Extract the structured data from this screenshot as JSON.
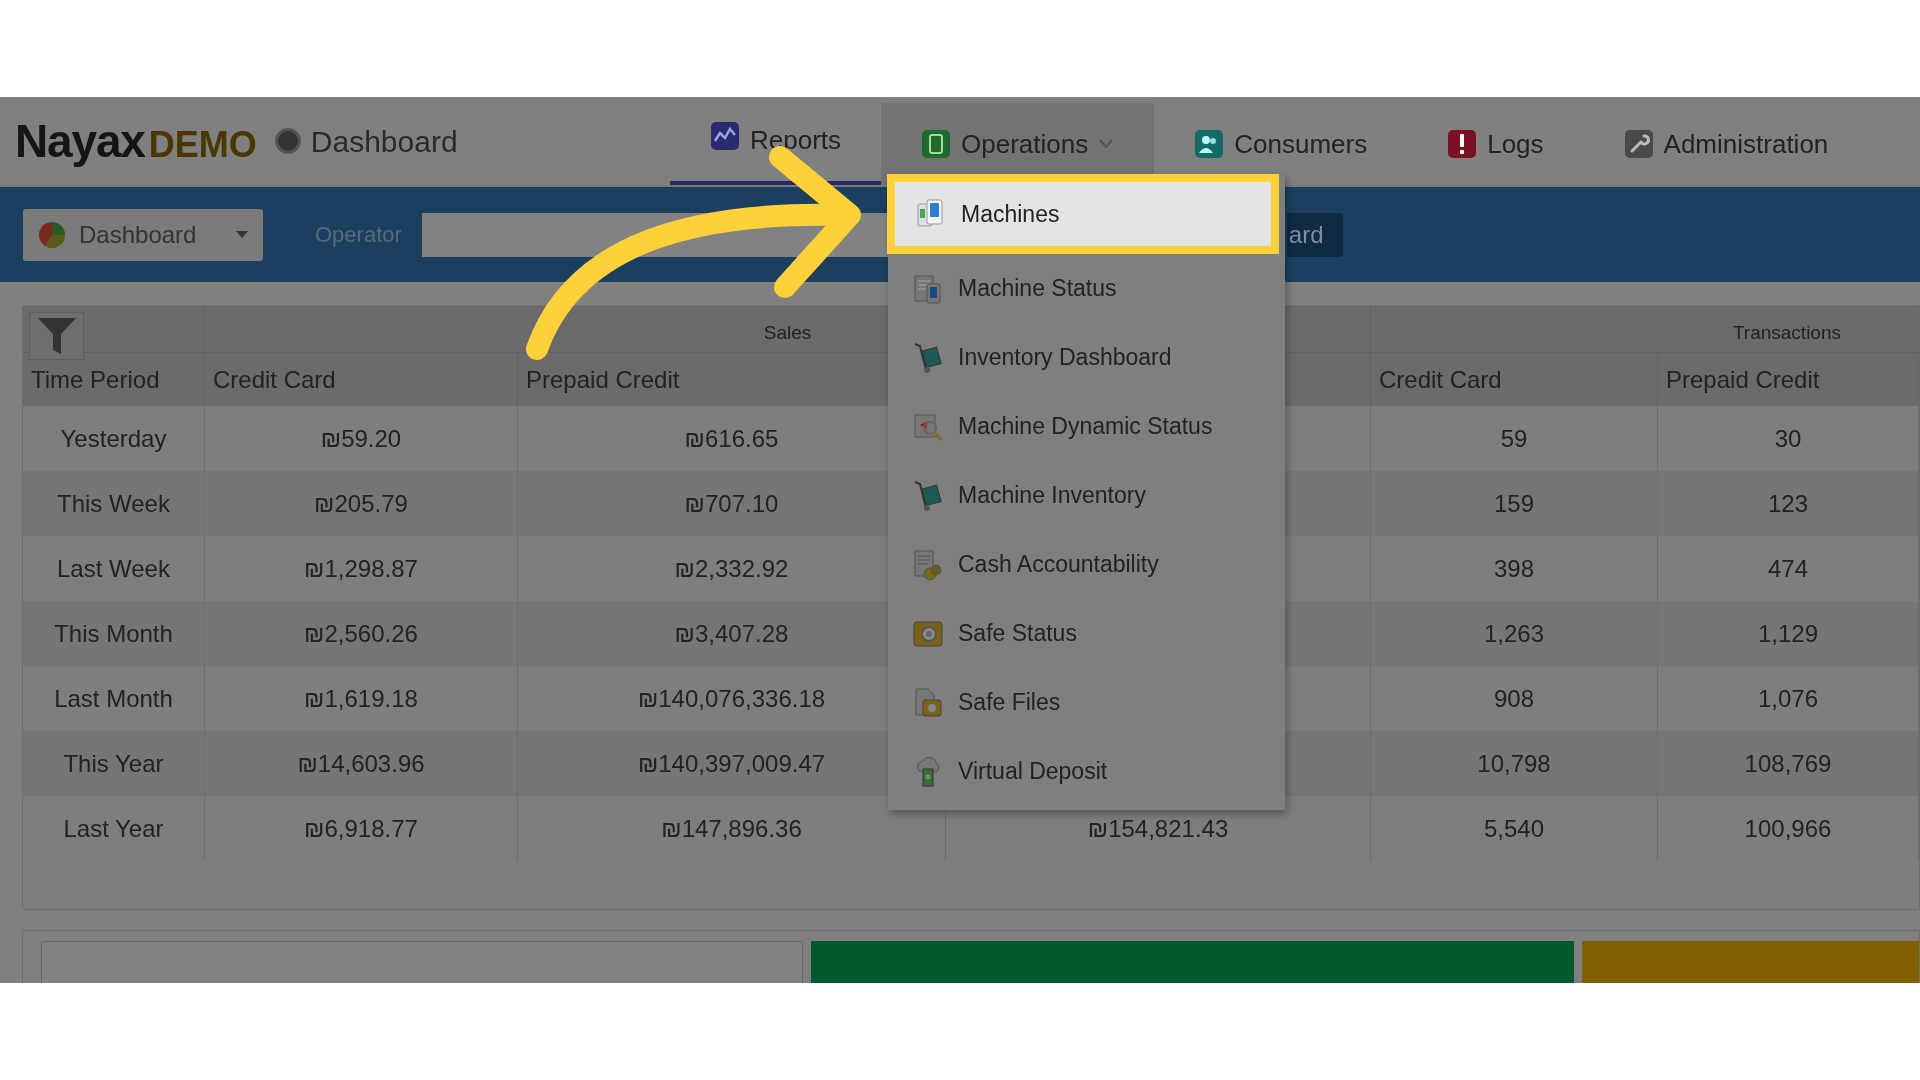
{
  "header": {
    "logo": {
      "name": "Nayax",
      "suffix": "DEMO"
    },
    "page_title": "Dashboard",
    "nav": [
      {
        "label": "Reports",
        "kind": "reports",
        "selected": true,
        "expanded": false
      },
      {
        "label": "Operations",
        "kind": "operations",
        "selected": false,
        "expanded": true
      },
      {
        "label": "Consumers",
        "kind": "consumers",
        "selected": false,
        "expanded": false
      },
      {
        "label": "Logs",
        "kind": "logs",
        "selected": false,
        "expanded": false
      },
      {
        "label": "Administration",
        "kind": "administration",
        "selected": false,
        "expanded": false
      }
    ]
  },
  "toolbar": {
    "view_select": "Dashboard",
    "operator_label": "Operator",
    "button": "ard"
  },
  "operations_menu": [
    {
      "label": "Machines",
      "kind": "machines",
      "highlighted": true
    },
    {
      "label": "Machine Status",
      "kind": "status",
      "highlighted": false
    },
    {
      "label": "Inventory Dashboard",
      "kind": "cart",
      "highlighted": false
    },
    {
      "label": "Machine Dynamic Status",
      "kind": "search",
      "highlighted": false
    },
    {
      "label": "Machine Inventory",
      "kind": "cart",
      "highlighted": false
    },
    {
      "label": "Cash Accountability",
      "kind": "cash",
      "highlighted": false
    },
    {
      "label": "Safe Status",
      "kind": "safe",
      "highlighted": false
    },
    {
      "label": "Safe Files",
      "kind": "files",
      "highlighted": false
    },
    {
      "label": "Virtual Deposit",
      "kind": "deposit",
      "highlighted": false
    }
  ],
  "table": {
    "groups": {
      "sales": "Sales",
      "transactions": "Transactions"
    },
    "headers": {
      "time_period": "Time Period",
      "sales_credit_card": "Credit Card",
      "sales_prepaid_credit": "Prepaid Credit",
      "tx_credit_card": "Credit Card",
      "tx_prepaid_credit": "Prepaid Credit"
    },
    "rows": [
      {
        "period": "Yesterday",
        "sales_credit_card": "₪59.20",
        "sales_prepaid_credit": "₪616.65",
        "tx_credit_card": "59",
        "tx_prepaid_credit": "30"
      },
      {
        "period": "This Week",
        "sales_credit_card": "₪205.79",
        "sales_prepaid_credit": "₪707.10",
        "tx_credit_card": "159",
        "tx_prepaid_credit": "123"
      },
      {
        "period": "Last Week",
        "sales_credit_card": "₪1,298.87",
        "sales_prepaid_credit": "₪2,332.92",
        "tx_credit_card": "398",
        "tx_prepaid_credit": "474"
      },
      {
        "period": "This Month",
        "sales_credit_card": "₪2,560.26",
        "sales_prepaid_credit": "₪3,407.28",
        "tx_credit_card": "1,263",
        "tx_prepaid_credit": "1,129"
      },
      {
        "period": "Last Month",
        "sales_credit_card": "₪1,619.18",
        "sales_prepaid_credit": "₪140,076,336.18",
        "tx_credit_card": "908",
        "tx_prepaid_credit": "1,076"
      },
      {
        "period": "This Year",
        "sales_credit_card": "₪14,603.96",
        "sales_prepaid_credit": "₪140,397,009.47",
        "tx_credit_card": "10,798",
        "tx_prepaid_credit": "108,769"
      },
      {
        "period": "Last Year",
        "sales_credit_card": "₪6,918.77",
        "sales_prepaid_credit": "₪147,896.36",
        "column_4": "₪154,821.43",
        "tx_credit_card": "5,540",
        "tx_prepaid_credit": "100,966"
      }
    ]
  }
}
